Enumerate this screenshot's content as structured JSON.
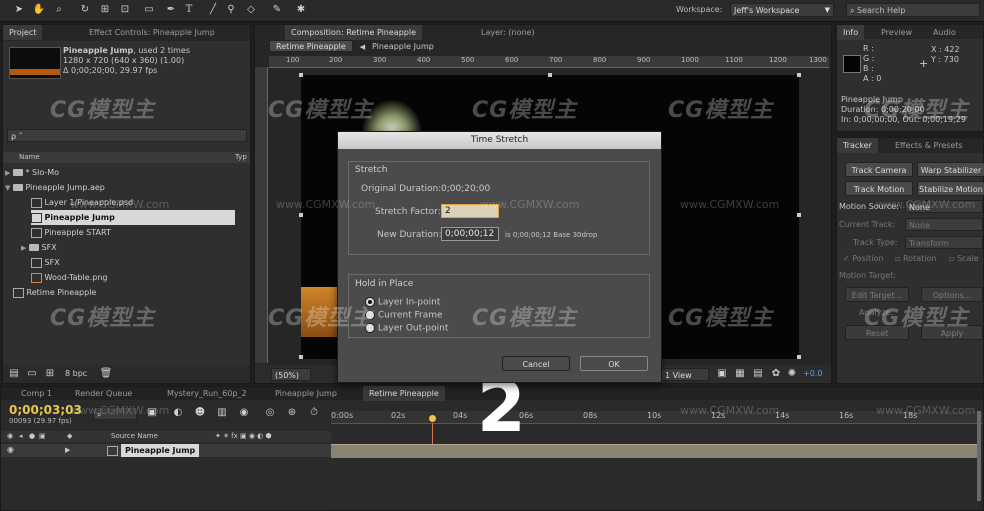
{
  "toolbar": {
    "workspace_label": "Workspace:",
    "workspace_value": "Jeff's Workspace",
    "search_placeholder": "Search Help"
  },
  "project_panel": {
    "tab_project": "Project",
    "tab_effect_controls": "Effect Controls: Pineapple Jump",
    "item_name": "Pineapple Jump",
    "item_used": ", used 2 times",
    "item_dims": "1280 x 720  (640 x 360) (1.00)",
    "item_duration": "Δ 0;00;20;00, 29.97 fps",
    "search_value": "ρ ˇ",
    "col_name": "Name",
    "col_type": "Typ",
    "items": [
      {
        "label": "* Slo-Mo"
      },
      {
        "label": "Pineapple Jump.aep"
      },
      {
        "label": "Layer 1/Pineapple.psd"
      },
      {
        "label": "Pineapple Jump"
      },
      {
        "label": "Pineapple START"
      },
      {
        "label": "SFX"
      },
      {
        "label": "SFX"
      },
      {
        "label": "Wood-Table.png"
      },
      {
        "label": "Retime Pineapple"
      }
    ],
    "bpc": "8 bpc"
  },
  "composition_panel": {
    "tab_label": "Composition: Retime Pineapple",
    "layer_label": "Layer: (none)",
    "crumb_active": "Retime Pineapple",
    "crumb_next": "Pineapple Jump",
    "ruler": [
      "100",
      "200",
      "300",
      "400",
      "500",
      "600",
      "700",
      "800",
      "900",
      "1000",
      "1100",
      "1200",
      "1300"
    ],
    "zoom": "(50%)",
    "view": "1 View",
    "exposure": "+0.0"
  },
  "dialog": {
    "title": "Time Stretch",
    "stretch_group": "Stretch",
    "original_duration_label": "Original Duration:",
    "original_duration_value": "0;00;20;00",
    "stretch_factor_label": "Stretch Factor:",
    "stretch_factor_value": "2",
    "new_duration_label": "New Duration:",
    "new_duration_value": "0;00;00;12",
    "new_duration_note": "is 0;00;00;12  Base 30drop",
    "hold_group": "Hold in Place",
    "options": [
      "Layer In-point",
      "Current Frame",
      "Layer Out-point"
    ],
    "selected_option": "Layer In-point",
    "cancel": "Cancel",
    "ok": "OK"
  },
  "info_panel": {
    "tab_info": "Info",
    "tab_preview": "Preview",
    "tab_audio": "Audio",
    "r": "R :",
    "g": "G :",
    "b": "B :",
    "a": "A :  0",
    "x": "X : 422",
    "y": "Y : 730",
    "comp_name": "Pineapple Jump",
    "duration": "Duration: 0;00;20;00",
    "inout": "In: 0;00;00;00, Out: 0;00;19;29"
  },
  "tracker_panel": {
    "tab_tracker": "Tracker",
    "tab_effects": "Effects & Presets",
    "track_camera": "Track Camera",
    "warp_stabilizer": "Warp Stabilizer",
    "track_motion": "Track Motion",
    "stabilize_motion": "Stabilize Motion",
    "motion_source_label": "Motion Source:",
    "motion_source_value": "None",
    "current_track_label": "Current Track:",
    "current_track_value": "None",
    "track_type_label": "Track Type:",
    "track_type_value": "Transform",
    "position": "Position",
    "rotation": "Rotation",
    "scale": "Scale",
    "motion_target": "Motion Target:",
    "edit_target": "Edit Target...",
    "options": "Options...",
    "analyze": "Analyze:",
    "reset": "Reset",
    "apply": "Apply"
  },
  "timeline": {
    "tabs": [
      "Comp 1",
      "Render Queue",
      "Mystery_Run_60p_2",
      "Pineapple Jump",
      "Retime Pineapple"
    ],
    "timecode": "0;00;03;03",
    "frames": "00093 (29.97 fps)",
    "source_name_col": "Source Name",
    "layer_name": "Pineapple Jump",
    "ticks": [
      "0:00s",
      "02s",
      "04s",
      "06s",
      "08s",
      "10s",
      "12s",
      "14s",
      "16s",
      "18s"
    ],
    "overlay_number": "2"
  },
  "watermark": {
    "logo": "CG模型主",
    "site": "www.CGMXW.com"
  },
  "colors": {
    "accent_orange": "#e0a040",
    "timecode_yellow": "#e8c84a",
    "selection": "#d8d8d8"
  }
}
